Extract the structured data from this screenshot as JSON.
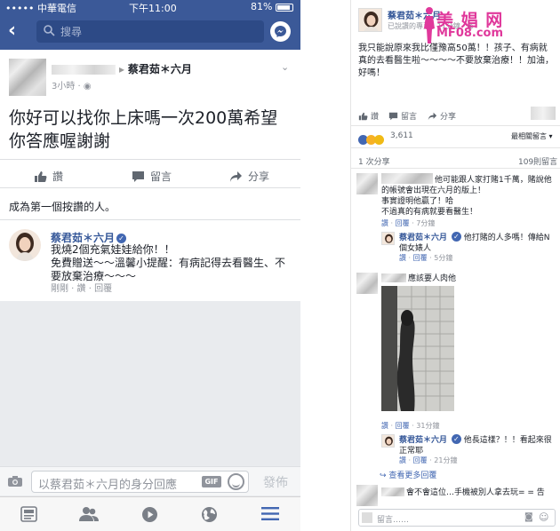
{
  "left": {
    "status": {
      "carrier": "••••• 中華電信",
      "time": "下午11:00",
      "battery": "81%"
    },
    "search": {
      "placeholder": "搜尋"
    },
    "post": {
      "author_suffix": "蔡君茹＊六月",
      "time": "3小時 · ",
      "text": "你好可以找你上床嗎一次200萬希望你答應喔謝謝",
      "actions": {
        "like": "讚",
        "comment": "留言",
        "share": "分享"
      },
      "first_like": "成為第一個按讚的人。"
    },
    "reply": {
      "name": "蔡君茹＊六月",
      "text": "我燒2個充氣娃娃給你！！\n免費贈送～～溫馨小提醒：有病記得去看醫生、不要放棄治療～～～",
      "meta": "剛剛 · 讚 · 回覆"
    },
    "composer": {
      "placeholder": "以蔡君茹＊六月的身分回應",
      "gif": "GIF",
      "send": "發佈"
    },
    "tabs": [
      "news-feed-icon",
      "friends-icon",
      "video-icon",
      "globe-icon",
      "menu-icon"
    ]
  },
  "right": {
    "page_name": "蔡君茹＊六月",
    "sub": "已說讚的專頁 · 11分鐘 · ",
    "watermark": {
      "line1": "美 娼 网",
      "line2": "MF08.com"
    },
    "post_text": "我只能說原來我比僅豫高50萬！！孩子、有病就真的去看醫生啦～～～～不要放棄治療！！加油，好嗎！",
    "actions": {
      "like": "讚",
      "comment": "留言",
      "share": "分享"
    },
    "reactions_count": "3,611",
    "most_relevant": "最相關留言 ▾",
    "shares": "1 次分享",
    "comments_count": "109則留言",
    "comments": [
      {
        "text": "他可能跟人家打賭1千萬，賭說他的帳號會出現在六月的版上！\n事實證明他贏了！哈\n不過真的有病就要看醫生！",
        "meta": {
          "like": "讚",
          "reply": "回覆",
          "time": "7分鐘"
        },
        "reply": {
          "name": "蔡君茹＊六月",
          "text": "他打賭的人多嗎！傳給N個女婊人",
          "meta": {
            "like": "讚",
            "reply": "回覆",
            "time": "5分鐘"
          }
        }
      },
      {
        "text": "應該要人肉他",
        "meta": {
          "like": "讚",
          "reply": "回覆",
          "time": "31分鐘"
        },
        "reply": {
          "name": "蔡君茹＊六月",
          "text": "他長這樣？！！看起來很正常耶",
          "meta": {
            "like": "讚",
            "reply": "回覆",
            "time": "21分鐘"
          }
        }
      }
    ],
    "more_replies": "查看更多回覆",
    "last_comment": "會不會這位…手機被別人拿去玩= = 告",
    "composer_placeholder": "留言……"
  },
  "colors": {
    "fb_blue": "#3b5998",
    "link": "#365899",
    "watermark": "#e0389b"
  }
}
